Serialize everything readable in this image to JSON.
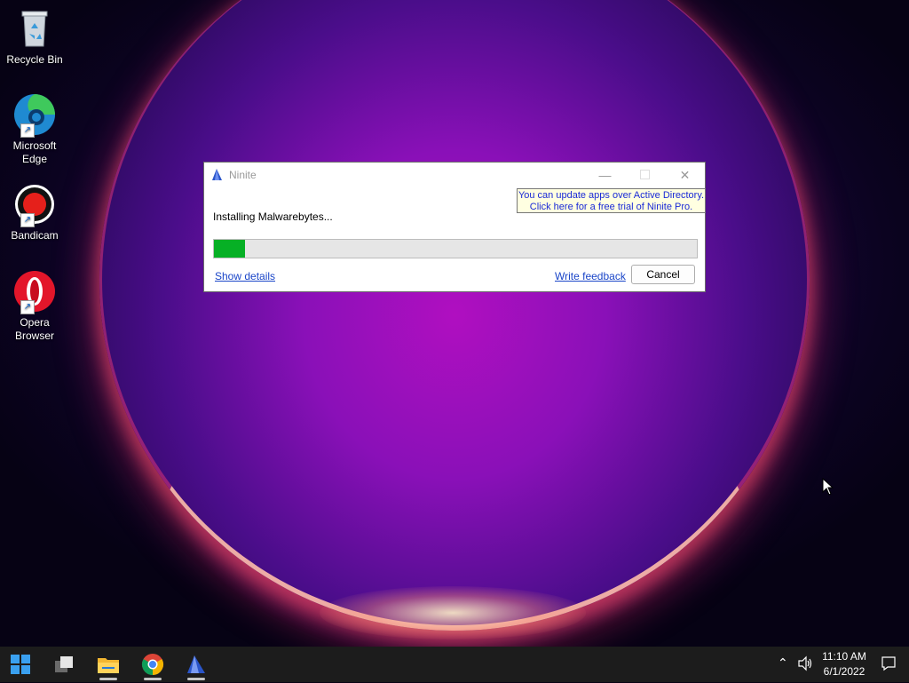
{
  "desktop": {
    "icons": [
      {
        "label_line1": "Recycle Bin",
        "label_line2": ""
      },
      {
        "label_line1": "Microsoft",
        "label_line2": "Edge"
      },
      {
        "label_line1": "Bandicam",
        "label_line2": ""
      },
      {
        "label_line1": "Opera",
        "label_line2": "Browser"
      }
    ]
  },
  "dialog": {
    "title": "Ninite",
    "promo_line1": "You can update apps over Active Directory.",
    "promo_line2": "Click here for a free trial of Ninite Pro.",
    "status": "Installing Malwarebytes...",
    "progress_fraction": 0.065,
    "show_details": "Show details",
    "write_feedback": "Write feedback",
    "cancel": "Cancel",
    "colors": {
      "progress": "#06b025",
      "link": "#1a45c8",
      "promo_bg": "#ffffe1"
    }
  },
  "taskbar": {
    "apps": [
      "start-icon",
      "task-view-icon",
      "file-explorer-icon",
      "chrome-icon",
      "ninite-icon"
    ],
    "time": "11:10 AM",
    "date": "6/1/2022"
  }
}
